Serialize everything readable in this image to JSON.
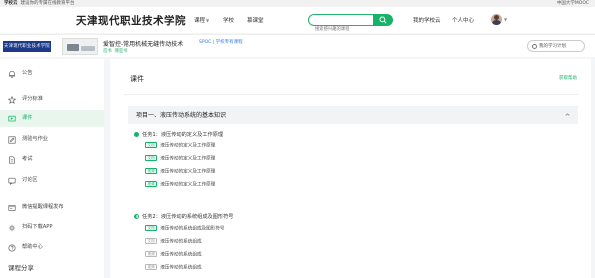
{
  "topbar": {
    "brand": "学校云",
    "tagline": "建设你的专属在线教育平台",
    "right_link": "中国大学MOOC"
  },
  "header": {
    "school_name": "天津现代职业技术学院",
    "nav": [
      "课程",
      "学校",
      "慕课堂"
    ],
    "search_placeholder": "搜索感兴趣的课程",
    "links": [
      "我的学校云",
      "个人中心"
    ]
  },
  "course": {
    "logo_text": "天津现代职业技术学院",
    "title": "爱智控-常用机械无缝传动技术",
    "tag": "SPOC | 学校专有课程",
    "meta": [
      "首书",
      "哪些书"
    ],
    "back_button": "我的学习",
    "back_button_full": "我的学习计划"
  },
  "sidebar": {
    "items": [
      {
        "label": "公告",
        "icon": "bell-icon"
      },
      {
        "label": "评分标准",
        "icon": "star-icon"
      },
      {
        "label": "课件",
        "icon": "courseware-icon"
      },
      {
        "label": "测验与作业",
        "icon": "edit-icon"
      },
      {
        "label": "考试",
        "icon": "exam-icon"
      },
      {
        "label": "讨论区",
        "icon": "discussion-icon"
      },
      {
        "label": "微信提醒课程发布",
        "icon": "wechat-icon"
      },
      {
        "label": "扫码下载APP",
        "icon": "qr-icon"
      },
      {
        "label": "帮助中心",
        "icon": "help-icon"
      }
    ],
    "active_index": 2,
    "share_title": "课程分享"
  },
  "main": {
    "title": "课件",
    "help_link": "获取帮助",
    "chapter_title": "项目一、液压传动系统的基本知识",
    "tasks": [
      {
        "title": "任务1：液压传动的定义及工作原理",
        "status": "complete",
        "resources": [
          {
            "tag": "文档",
            "label": "液压传动的定义及工作原理",
            "tag_style": "green"
          },
          {
            "tag": "文档",
            "label": "液压传动的定义及工作原理",
            "tag_style": "green"
          },
          {
            "tag": "视频",
            "label": "液压传动的定义及工作原理",
            "tag_style": "green"
          },
          {
            "tag": "视频",
            "label": "液压传动的定义及工作原理",
            "tag_style": "green"
          }
        ]
      },
      {
        "title": "任务2：液压传动的系统组成及图形符号",
        "status": "partial",
        "resources": [
          {
            "tag": "文档",
            "label": "液压传动的系统组成及图形符号",
            "tag_style": "green"
          },
          {
            "tag": "文档",
            "label": "液压传动的系统组成",
            "tag_style": "gray"
          },
          {
            "tag": "视频",
            "label": "液压传动的系统组成",
            "tag_style": "gray"
          },
          {
            "tag": "视频",
            "label": "液压传动的系统组成",
            "tag_style": "gray"
          }
        ]
      }
    ]
  },
  "colors": {
    "accent": "#19b26b",
    "link_blue": "#2d7de0",
    "active_bg": "#e8f6ee"
  }
}
